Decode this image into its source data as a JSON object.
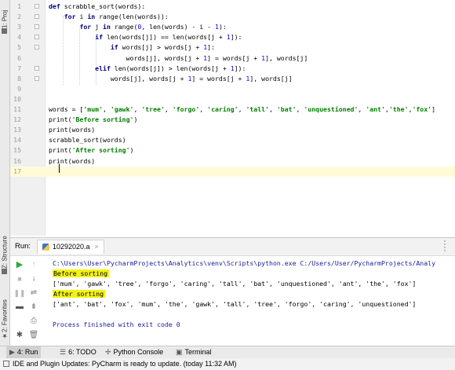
{
  "left_strip": {
    "project_tab": "1: Proj",
    "structure_tab": "Z: Structure",
    "favorites_tab": "2: Favorites"
  },
  "editor": {
    "lines": [
      {
        "n": "1",
        "code": "def scrabble_sort(words):"
      },
      {
        "n": "2",
        "code": "    for i in range(len(words)):"
      },
      {
        "n": "3",
        "code": "        for j in range(0, len(words) - i - 1):"
      },
      {
        "n": "4",
        "code": "            if len(words[j]) == len(words[j + 1]):"
      },
      {
        "n": "5",
        "code": "                if words[j] > words[j + 1]:"
      },
      {
        "n": "6",
        "code": "                    words[j], words[j + 1] = words[j + 1], words[j]"
      },
      {
        "n": "7",
        "code": "            elif len(words[j]) > len(words[j + 1]):"
      },
      {
        "n": "8",
        "code": "                words[j], words[j + 1] = words[j + 1], words[j]"
      },
      {
        "n": "9",
        "code": ""
      },
      {
        "n": "10",
        "code": ""
      },
      {
        "n": "11",
        "code": "words = ['mum', 'gawk', 'tree', 'forgo', 'caring', 'tall', 'bat', 'unquestioned', 'ant','the','fox']"
      },
      {
        "n": "12",
        "code": "print('Before sorting')"
      },
      {
        "n": "13",
        "code": "print(words)"
      },
      {
        "n": "14",
        "code": "scrabble_sort(words)"
      },
      {
        "n": "15",
        "code": "print('After sorting')"
      },
      {
        "n": "16",
        "code": "print(words)"
      },
      {
        "n": "17",
        "code": ""
      }
    ]
  },
  "run_panel": {
    "label": "Run:",
    "tab_title": "10292020.a",
    "close_glyph": "×",
    "console": {
      "command": "C:\\Users\\User\\PycharmProjects\\Analytics\\venv\\Scripts\\python.exe C:/Users/User/PycharmProjects/Analy",
      "before_label": "Before sorting",
      "before_list": "['mum', 'gawk', 'tree', 'forgo', 'caring', 'tall', 'bat', 'unquestioned', 'ant', 'the', 'fox']",
      "after_label": "After sorting",
      "after_list": "['ant', 'bat', 'fox', 'mum', 'the', 'gawk', 'tall', 'tree', 'forgo', 'caring', 'unquestioned']",
      "exit_message": "Process finished with exit code 0"
    }
  },
  "bottom_tabs": {
    "run": "4: Run",
    "todo": "6: TODO",
    "python_console": "Python Console",
    "terminal": "Terminal"
  },
  "status_bar": {
    "message": "IDE and Plugin Updates: PyCharm is ready to update. (today 11:32 AM)"
  },
  "colors": {
    "highlight": "#f3f312",
    "keyword": "#00007f",
    "string": "#008000",
    "run_green": "#2fa83a"
  }
}
